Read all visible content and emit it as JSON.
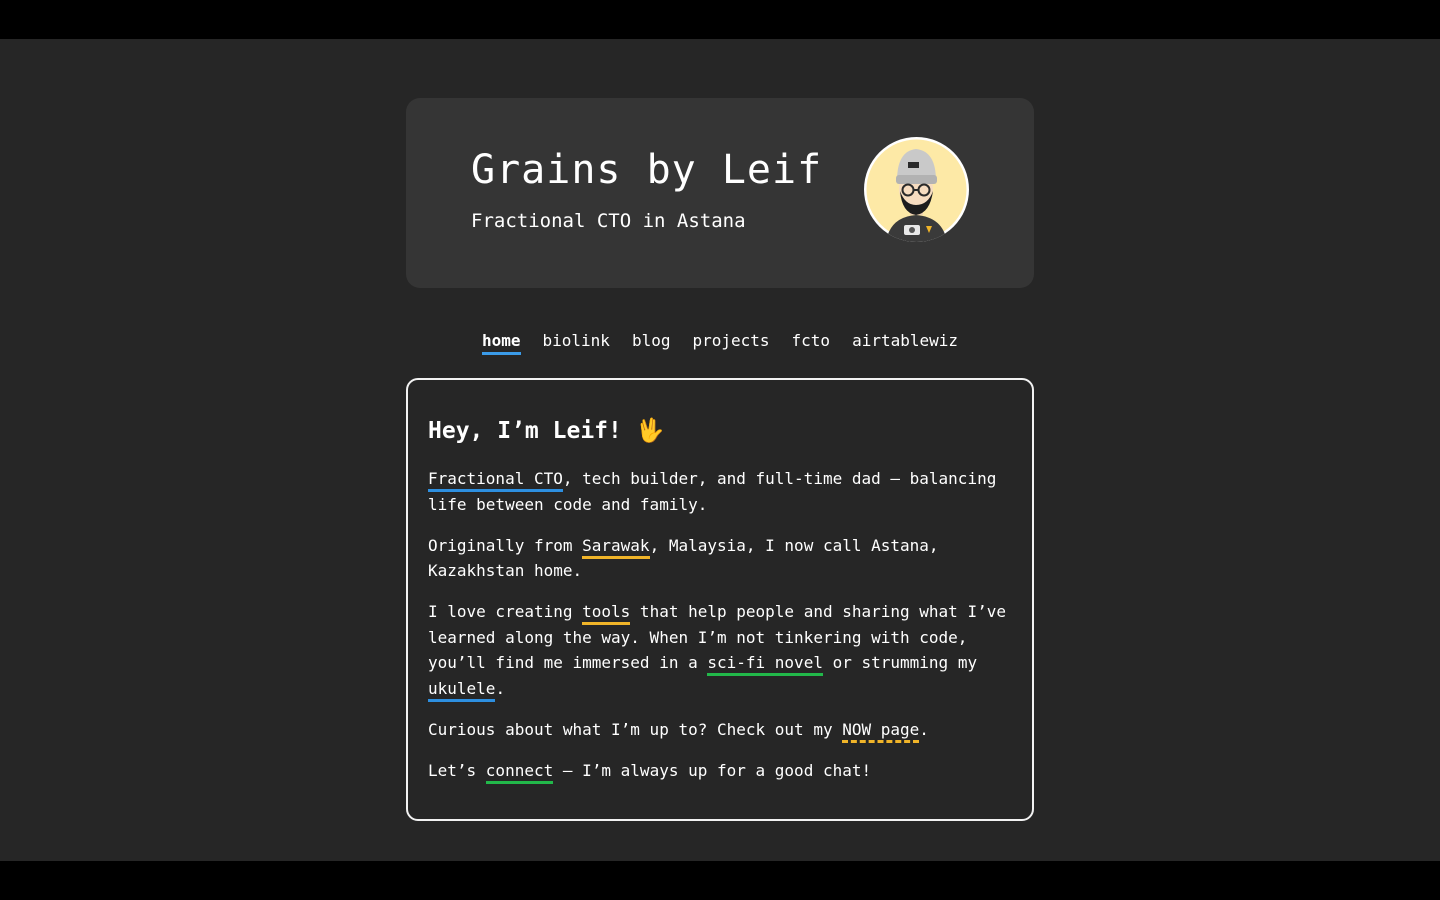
{
  "header": {
    "title": "Grains by Leif",
    "subtitle": "Fractional CTO in Astana"
  },
  "nav": {
    "items": [
      {
        "label": "home",
        "active": true
      },
      {
        "label": "biolink",
        "active": false
      },
      {
        "label": "blog",
        "active": false
      },
      {
        "label": "projects",
        "active": false
      },
      {
        "label": "fcto",
        "active": false
      },
      {
        "label": "airtablewiz",
        "active": false
      }
    ]
  },
  "intro": {
    "greeting": "Hey, I’m Leif!",
    "greeting_emoji": "🖖",
    "p1": {
      "link": "Fractional CTO",
      "text": ", tech builder, and full-time dad — balancing life between code and family."
    },
    "p2": {
      "before": "Originally from ",
      "link": "Sarawak",
      "after": ", Malaysia, I now call Astana, Kazakhstan home."
    },
    "p3": {
      "before": "I love creating ",
      "link1": "tools",
      "middle": " that help people and sharing what I’ve learned along the way. When I’m not tinkering with code, you’ll find me immersed in a ",
      "link2": "sci-fi novel",
      "middle2": " or strumming my ",
      "link3": "ukulele",
      "after": "."
    },
    "p4": {
      "before": "Curious about what I’m up to? Check out my ",
      "link": "NOW page",
      "after": "."
    },
    "p5": {
      "before": "Let’s ",
      "link": "connect",
      "after": " — I’m always up for a good chat!"
    }
  },
  "colors": {
    "background": "#262626",
    "header_card": "#353535",
    "accent_blue": "#2d8fe0",
    "accent_yellow": "#f0b429",
    "accent_green": "#22b84a"
  }
}
